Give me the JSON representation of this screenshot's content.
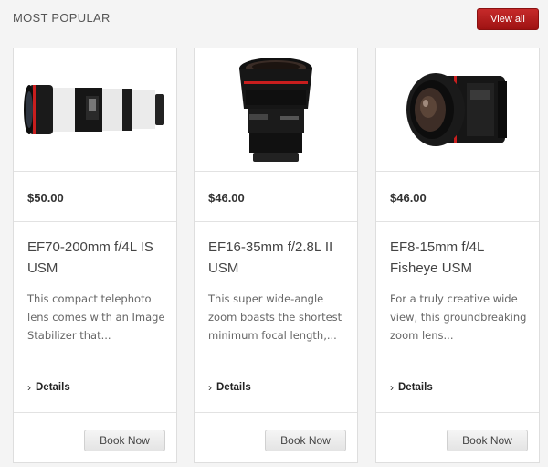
{
  "header": {
    "title": "MOST POPULAR",
    "view_all_label": "View all"
  },
  "products": [
    {
      "image": "telephoto-zoom-lens-white",
      "price": "$50.00",
      "name": "EF70-200mm f/4L IS USM",
      "description": "This compact telephoto lens comes with an Image Stabilizer that...",
      "details_label": "Details",
      "book_label": "Book Now"
    },
    {
      "image": "wide-angle-zoom-lens-black",
      "price": "$46.00",
      "name": "EF16-35mm f/2.8L II USM",
      "description": "This super wide-angle zoom boasts the shortest minimum focal length,...",
      "details_label": "Details",
      "book_label": "Book Now"
    },
    {
      "image": "fisheye-zoom-lens-black",
      "price": "$46.00",
      "name": "EF8-15mm f/4L Fisheye USM",
      "description": "For a truly creative wide view, this groundbreaking zoom lens...",
      "details_label": "Details",
      "book_label": "Book Now"
    }
  ],
  "colors": {
    "accent": "#b01c1c",
    "page_background": "#f4f4f4"
  }
}
